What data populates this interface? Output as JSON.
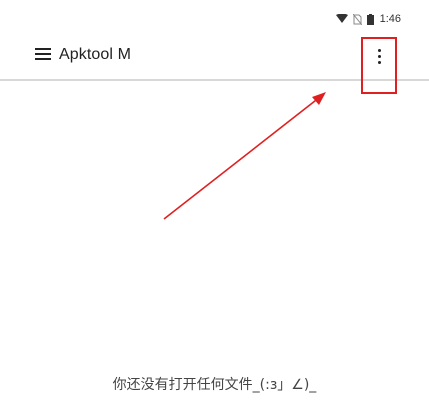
{
  "status_bar": {
    "time": "1:46",
    "icons": [
      "wifi-icon",
      "no-sim-icon",
      "battery-icon"
    ]
  },
  "toolbar": {
    "title": "Apktool M",
    "menu_icon": "hamburger-menu-icon",
    "overflow_icon": "more-vert-icon"
  },
  "main": {
    "empty_message": "你还没有打开任何文件_(:з」∠)_"
  },
  "annotations": {
    "color": "#e02020",
    "highlight_target": "overflow-menu-button"
  }
}
